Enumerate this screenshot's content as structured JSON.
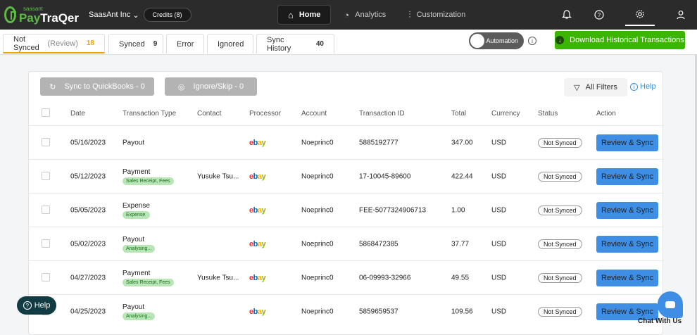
{
  "brand": {
    "small": "saasant",
    "name_a": "Pay",
    "name_b": "TraQer"
  },
  "company": "SaasAnt Inc",
  "credits": "Credits (8)",
  "nav": [
    {
      "label": "Home",
      "icon": "⌂"
    },
    {
      "label": "Analytics",
      "icon": "◔"
    },
    {
      "label": "Customization",
      "icon": "⫶"
    }
  ],
  "tabs": [
    {
      "label": "Not Synced",
      "sub": "(Review)",
      "count": "18"
    },
    {
      "label": "Synced",
      "count": "9"
    },
    {
      "label": "Error"
    },
    {
      "label": "Ignored"
    },
    {
      "label": "Sync History",
      "count": "40"
    }
  ],
  "automation_label": "Automation",
  "download_label": "Download Historical Transactions",
  "actions": {
    "sync": "Sync to QuickBooks - 0",
    "ignore": "Ignore/Skip - 0",
    "filters": "All Filters",
    "help": "Help"
  },
  "columns": [
    "Date",
    "Transaction Type",
    "Contact",
    "Processor",
    "Account",
    "Transaction ID",
    "Total",
    "Currency",
    "Status",
    "Action"
  ],
  "rows": [
    {
      "date": "05/16/2023",
      "type": "Payout",
      "tag": "",
      "contact": "",
      "account": "Noeprinc0",
      "txid": "5885192777",
      "total": "347.00",
      "currency": "USD",
      "status": "Not Synced",
      "action": "Review & Sync"
    },
    {
      "date": "05/12/2023",
      "type": "Payment",
      "tag": "Sales Receipt, Fees",
      "contact": "Yusuke Tsu...",
      "account": "Noeprinc0",
      "txid": "17-10045-89600",
      "total": "422.44",
      "currency": "USD",
      "status": "Not Synced",
      "action": "Review & Sync"
    },
    {
      "date": "05/05/2023",
      "type": "Expense",
      "tag": "Expense",
      "contact": "",
      "account": "Noeprinc0",
      "txid": "FEE-5077324906713",
      "total": "1.00",
      "currency": "USD",
      "status": "Not Synced",
      "action": "Review & Sync"
    },
    {
      "date": "05/02/2023",
      "type": "Payout",
      "tag": "Analysing...",
      "contact": "",
      "account": "Noeprinc0",
      "txid": "5868472385",
      "total": "37.77",
      "currency": "USD",
      "status": "Not Synced",
      "action": "Review & Sync"
    },
    {
      "date": "04/27/2023",
      "type": "Payment",
      "tag": "Sales Receipt, Fees",
      "contact": "Yusuke Tsu...",
      "account": "Noeprinc0",
      "txid": "06-09993-32966",
      "total": "49.55",
      "currency": "USD",
      "status": "Not Synced",
      "action": "Review & Sync"
    },
    {
      "date": "04/25/2023",
      "type": "Payout",
      "tag": "Analysing...",
      "contact": "",
      "account": "Noeprinc0",
      "txid": "5859659537",
      "total": "109.56",
      "currency": "USD",
      "status": "Not Synced",
      "action": "Review & Sync"
    }
  ],
  "processor": {
    "e": "e",
    "b": "b",
    "a": "a",
    "y": "y"
  },
  "help_float": "Help",
  "chat_label": "Chat With Us",
  "colors": {
    "accent": "#3e8ee6",
    "green": "#3bb500",
    "topbar": "#2b2b2b",
    "tab_active": "#f0a500"
  }
}
